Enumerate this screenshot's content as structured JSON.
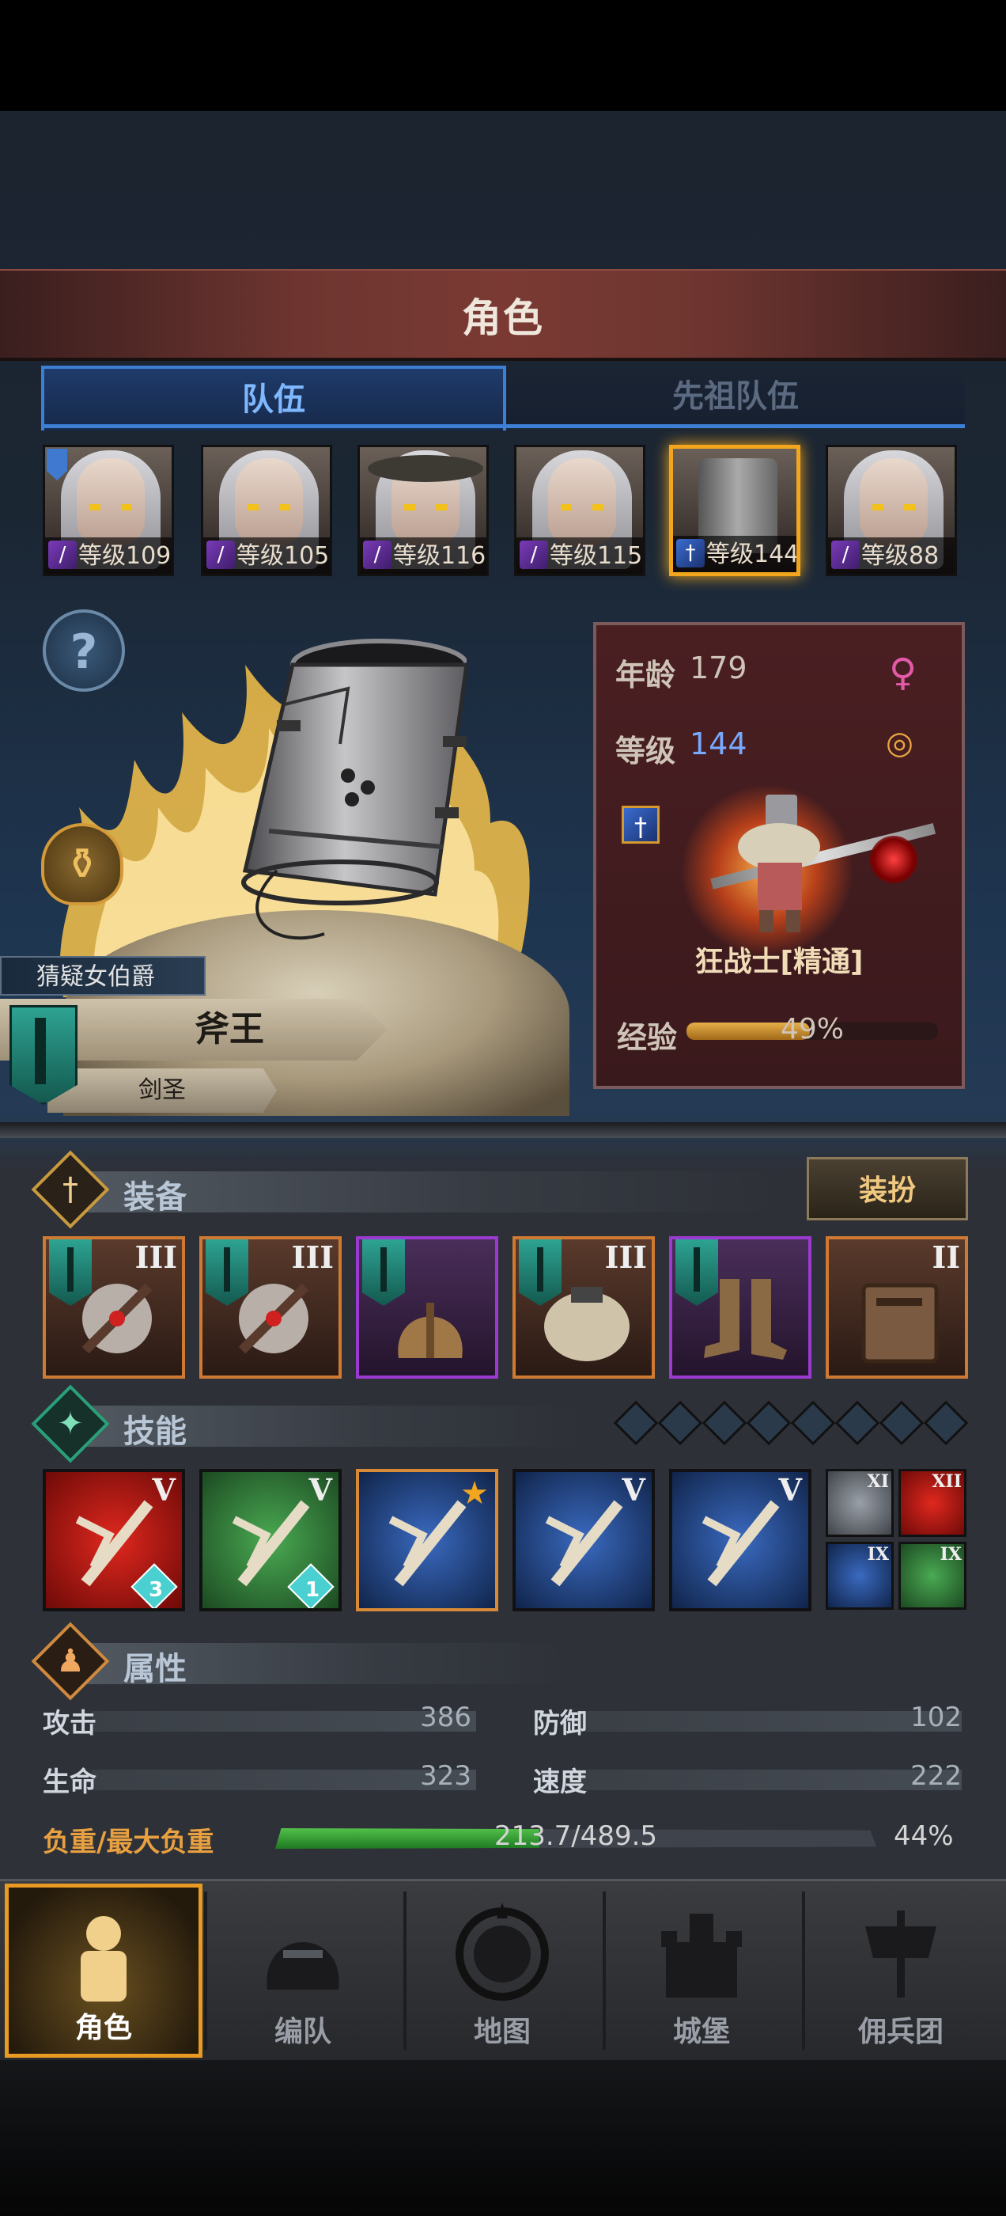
{
  "header": {
    "title": "角色"
  },
  "tabs": [
    {
      "label": "队伍",
      "active": true
    },
    {
      "label": "先祖队伍",
      "active": false
    }
  ],
  "roster": [
    {
      "level_text": "等级109",
      "class_icon": "staff-icon",
      "selected": false
    },
    {
      "level_text": "等级105",
      "class_icon": "staff-icon",
      "selected": false
    },
    {
      "level_text": "等级116",
      "class_icon": "staff-icon",
      "selected": false
    },
    {
      "level_text": "等级115",
      "class_icon": "staff-icon",
      "selected": false
    },
    {
      "level_text": "等级144",
      "class_icon": "sword-icon",
      "selected": true
    },
    {
      "level_text": "等级88",
      "class_icon": "staff-icon",
      "selected": false
    }
  ],
  "character": {
    "title": "猜疑女伯爵",
    "name": "斧王",
    "class_rank": "剑圣",
    "age_label": "年龄",
    "age": "179",
    "level_label": "等级",
    "level": "144",
    "class_full": "狂战士[精通]",
    "exp_label": "经验",
    "exp_percent": 49,
    "exp_text": "49%"
  },
  "equipment": {
    "title": "装备",
    "outfit_button": "装扮",
    "items": [
      {
        "tier": "III",
        "rarity": "orange",
        "banner": true,
        "item": "axe"
      },
      {
        "tier": "III",
        "rarity": "orange",
        "banner": true,
        "item": "axe"
      },
      {
        "tier": "",
        "rarity": "purple",
        "banner": true,
        "item": "helmet"
      },
      {
        "tier": "III",
        "rarity": "orange",
        "banner": true,
        "item": "fur-armor"
      },
      {
        "tier": "",
        "rarity": "purple",
        "banner": true,
        "item": "boots"
      },
      {
        "tier": "II",
        "rarity": "orange",
        "banner": false,
        "item": "book"
      }
    ]
  },
  "skills": {
    "title": "技能",
    "empty_slots": 8,
    "items": [
      {
        "tier": "V",
        "color": "red",
        "gem": "3",
        "star": false
      },
      {
        "tier": "V",
        "color": "green",
        "gem": "1",
        "star": false
      },
      {
        "tier": "",
        "color": "blue",
        "gem": "",
        "star": true
      },
      {
        "tier": "V",
        "color": "blue",
        "gem": "",
        "star": false
      },
      {
        "tier": "V",
        "color": "blue",
        "gem": "",
        "star": false
      }
    ],
    "mini": [
      {
        "tier": "XI",
        "color": "gray"
      },
      {
        "tier": "XII",
        "color": "red"
      },
      {
        "tier": "IX",
        "color": "blue"
      },
      {
        "tier": "IX",
        "color": "green"
      }
    ]
  },
  "attributes": {
    "title": "属性",
    "attack_label": "攻击",
    "attack": "386",
    "defense_label": "防御",
    "defense": "102",
    "hp_label": "生命",
    "hp": "323",
    "speed_label": "速度",
    "speed": "222",
    "weight_label": "负重/最大负重",
    "weight_text": "213.7/489.5",
    "weight_percent_text": "44%",
    "weight_fraction": 0.44
  },
  "nav": [
    {
      "label": "角色",
      "icon": "knight-icon",
      "active": true
    },
    {
      "label": "编队",
      "icon": "helmet-icon",
      "active": false
    },
    {
      "label": "地图",
      "icon": "compass-icon",
      "active": false
    },
    {
      "label": "城堡",
      "icon": "castle-icon",
      "active": false
    },
    {
      "label": "佣兵团",
      "icon": "banner-icon",
      "active": false
    }
  ],
  "colors": {
    "accent_blue": "#3c7fd4",
    "selected_gold": "#f2a61e",
    "header_red": "#7a3a33",
    "weight_green": "#52c04a"
  }
}
